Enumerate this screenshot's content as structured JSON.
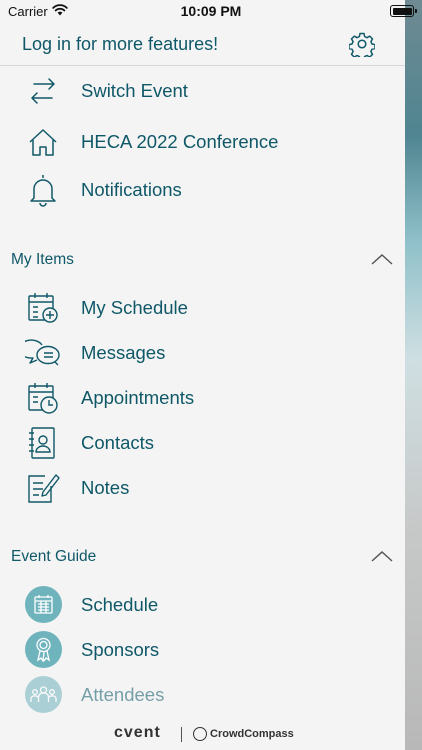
{
  "status_bar": {
    "carrier": "Carrier",
    "time": "10:09 PM"
  },
  "header": {
    "login_text": "Log in for more features!",
    "settings_icon": "gear-icon"
  },
  "top_items": [
    {
      "label": "Switch Event",
      "icon": "swap-arrows-icon"
    },
    {
      "label": "HECA 2022 Conference",
      "icon": "home-icon"
    },
    {
      "label": "Notifications",
      "icon": "bell-icon"
    }
  ],
  "my_items": {
    "title": "My Items",
    "items": [
      {
        "label": "My Schedule",
        "icon": "calendar-add-icon"
      },
      {
        "label": "Messages",
        "icon": "chat-bubbles-icon"
      },
      {
        "label": "Appointments",
        "icon": "calendar-clock-icon"
      },
      {
        "label": "Contacts",
        "icon": "address-book-icon"
      },
      {
        "label": "Notes",
        "icon": "note-pencil-icon"
      }
    ]
  },
  "event_guide": {
    "title": "Event Guide",
    "items": [
      {
        "label": "Schedule",
        "icon": "calendar-icon"
      },
      {
        "label": "Sponsors",
        "icon": "ribbon-award-icon"
      },
      {
        "label": "Attendees",
        "icon": "people-icon"
      }
    ]
  },
  "footer": {
    "brand": "cvent",
    "partner": "CrowdCompass"
  },
  "colors": {
    "accent": "#0f5868",
    "icon_circle": "#6fb3bd",
    "background": "#f4f4f4"
  }
}
